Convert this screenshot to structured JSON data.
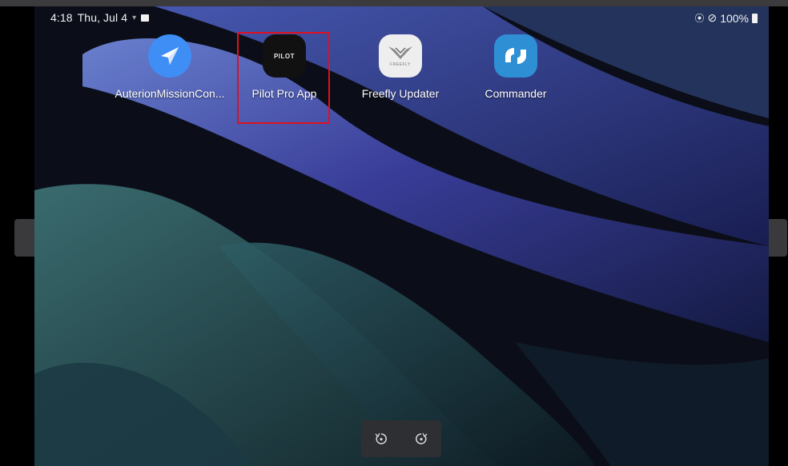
{
  "status_bar": {
    "time": "4:18",
    "date": "Thu, Jul 4",
    "battery": "100%"
  },
  "apps": [
    {
      "label": "AuterionMissionCon...",
      "icon": "paper-plane-icon",
      "color": "#3e8ef5"
    },
    {
      "label": "Pilot Pro App",
      "icon": "pilot-pro-icon",
      "color": "#111111",
      "icon_text": "PILOT"
    },
    {
      "label": "Freefly Updater",
      "icon": "freefly-icon",
      "color": "#eeeeee",
      "icon_text": "FREEFLY"
    },
    {
      "label": "Commander",
      "icon": "commander-icon",
      "color": "#2f8fd4"
    }
  ],
  "navigation": {
    "prev_glyph": "〈",
    "next_glyph": "〉"
  },
  "colors": {
    "highlight": "#e0101f",
    "wallpaper_dark": "#0a0c14",
    "wallpaper_blue": "#3a3f9a",
    "wallpaper_teal": "#2b5a5f"
  }
}
